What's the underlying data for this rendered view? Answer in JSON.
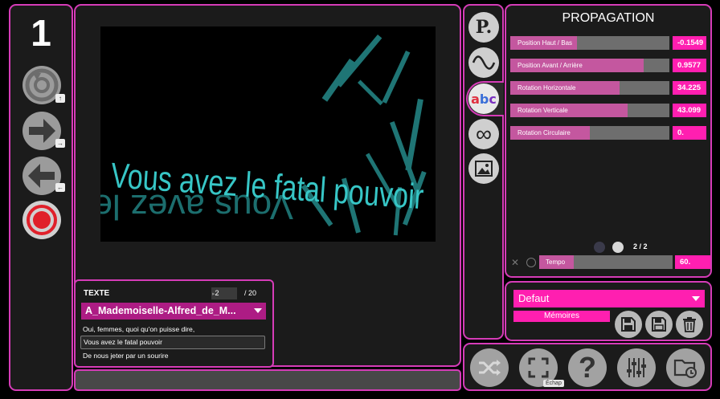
{
  "left_bar": {
    "number": "1",
    "hints": {
      "rotate": "↑",
      "next": "→",
      "prev": "←"
    }
  },
  "preview": {
    "line1": "Vous avez le fatal pouvoir",
    "line2": "De nous jeter par un sourire",
    "colors": {
      "text": "#2fb8b8",
      "background": "#000000"
    }
  },
  "texte_panel": {
    "title": "TEXTE",
    "page_value": "2",
    "page_total": "/ 20",
    "selected_text": "A_Mademoiselle-Alfred_de_M...",
    "lines": [
      "Oui, femmes, quoi qu'on puisse dire,",
      "Vous avez le fatal pouvoir",
      "De nous jeter par un sourire"
    ],
    "active_line": 1
  },
  "tools": [
    {
      "icon": "pen-icon",
      "glyph": "P."
    },
    {
      "icon": "wave-icon"
    },
    {
      "icon": "abc-icon",
      "glyph": "abc",
      "selected": true
    },
    {
      "icon": "infinity-icon",
      "glyph": "∞"
    },
    {
      "icon": "image-icon"
    }
  ],
  "propagation": {
    "title": "PROPAGATION",
    "sliders": [
      {
        "label": "Position Haut / Bas",
        "value": "-0.1549",
        "fill": 0.42
      },
      {
        "label": "Position Avant / Arrière",
        "value": "0.9577",
        "fill": 0.84
      },
      {
        "label": "Rotation Horizontale",
        "value": "34.225",
        "fill": 0.69
      },
      {
        "label": "Rotation Verticale",
        "value": "43.099",
        "fill": 0.74
      },
      {
        "label": "Rotation Circulaire",
        "value": "0.",
        "fill": 0.5
      }
    ],
    "pager": "2 / 2",
    "tempo": {
      "label": "Tempo",
      "value": "60.",
      "fill": 0.26
    }
  },
  "presets": {
    "dropdown": "Defaut",
    "memories_label": "Mémoires"
  },
  "bottom_toolbar": {
    "escape_hint": "Échap"
  }
}
